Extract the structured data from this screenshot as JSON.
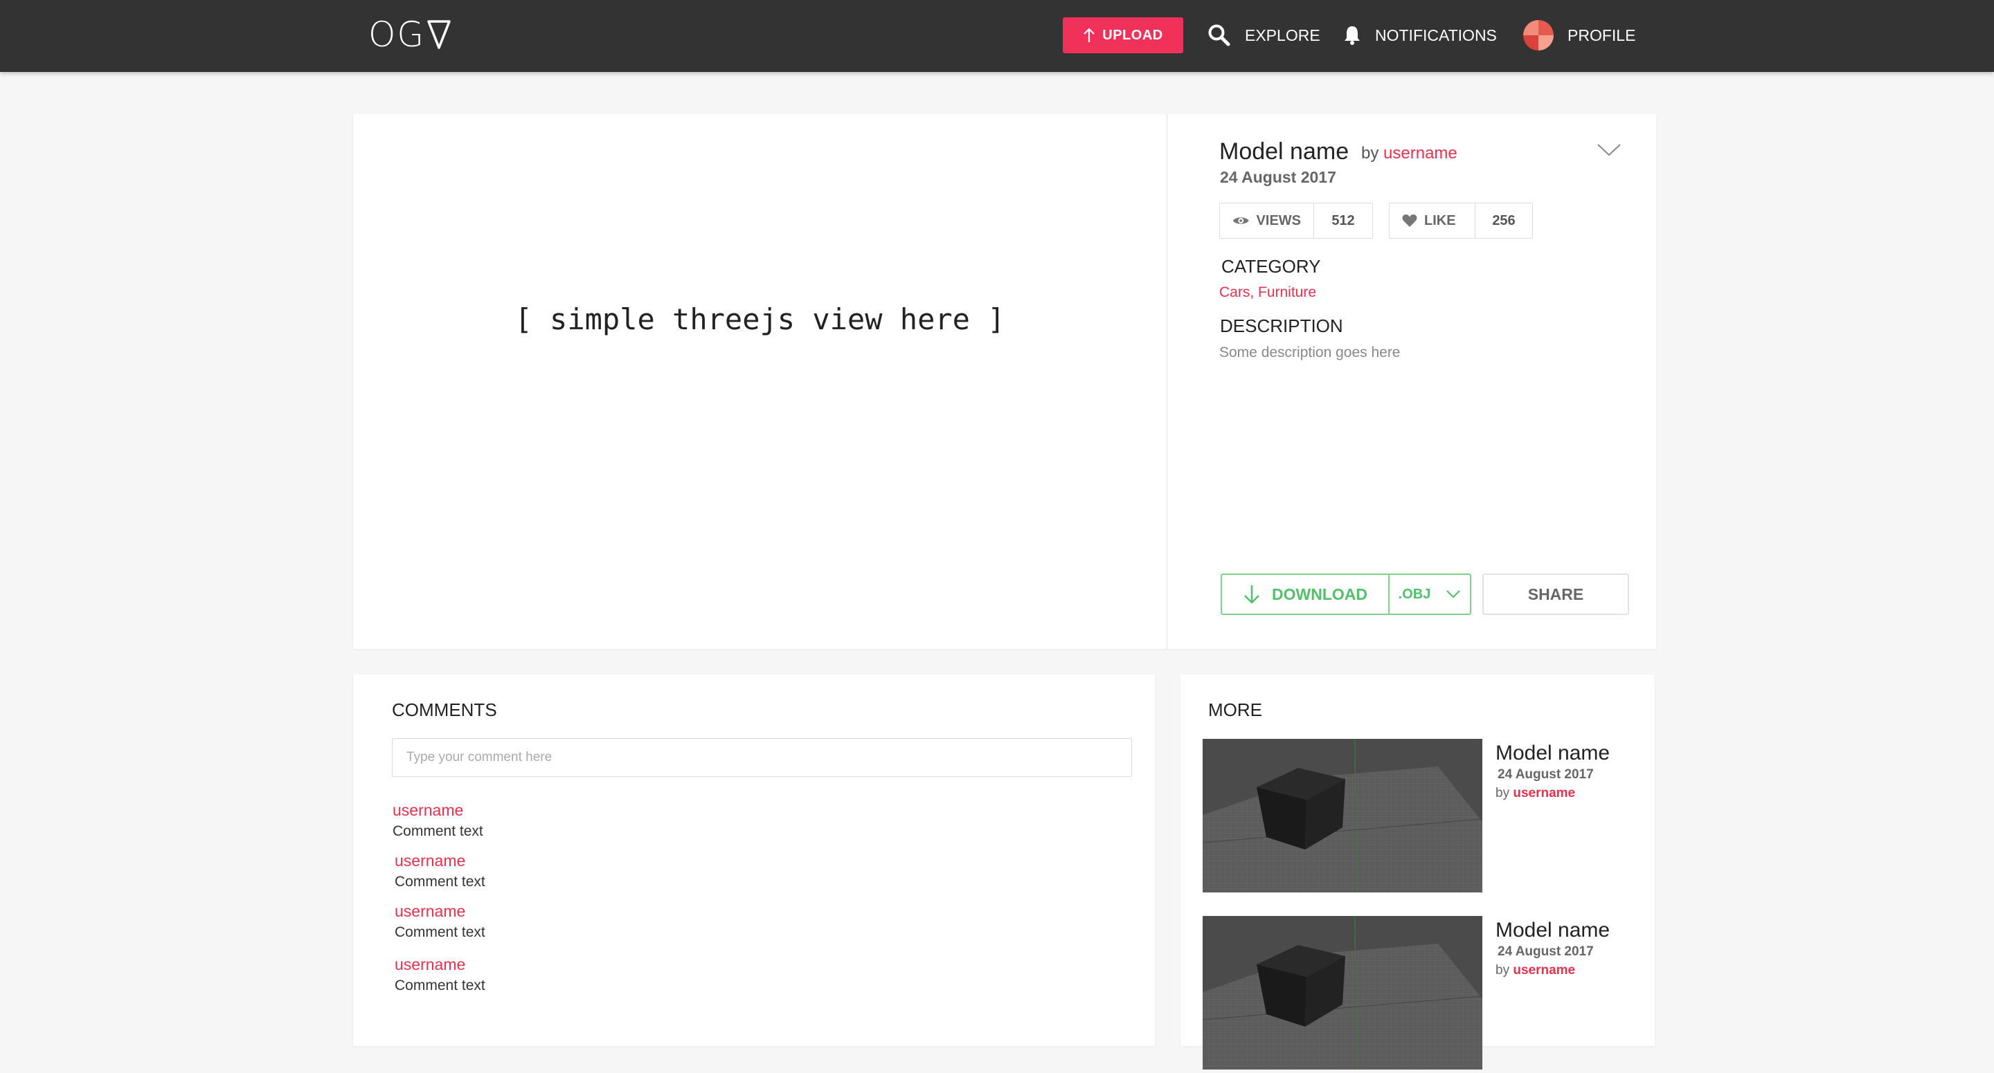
{
  "brand": {
    "logo_text": "OG"
  },
  "nav": {
    "upload": "UPLOAD",
    "explore": "EXPLORE",
    "notifications": "NOTIFICATIONS",
    "profile": "PROFILE"
  },
  "model": {
    "viewer_placeholder": "[ simple threejs view here ]",
    "name": "Model name",
    "by_prefix": "by",
    "username": "username",
    "date": "24 August 2017",
    "views_label": "VIEWS",
    "views_count": "512",
    "like_label": "LIKE",
    "like_count": "256",
    "category_heading": "CATEGORY",
    "categories": "Cars, Furniture",
    "description_heading": "DESCRIPTION",
    "description": "Some description goes here",
    "download_label": "DOWNLOAD",
    "format": ".OBJ",
    "share_label": "SHARE"
  },
  "comments": {
    "title": "COMMENTS",
    "placeholder": "Type your comment here",
    "items": [
      {
        "user": "username",
        "text": "Comment text"
      },
      {
        "user": "username",
        "text": "Comment text"
      },
      {
        "user": "username",
        "text": "Comment text"
      },
      {
        "user": "username",
        "text": "Comment text"
      }
    ]
  },
  "more": {
    "title": "MORE",
    "items": [
      {
        "name": "Model name",
        "date": "24 August 2017",
        "by_prefix": "by",
        "user": "username"
      },
      {
        "name": "Model name",
        "date": "24 August 2017",
        "by_prefix": "by",
        "user": "username"
      }
    ]
  },
  "colors": {
    "topbar": "#333333",
    "accent": "#f0325a",
    "link": "#e8304f",
    "download": "#52c06a",
    "page_bg": "#f6f6f6"
  }
}
